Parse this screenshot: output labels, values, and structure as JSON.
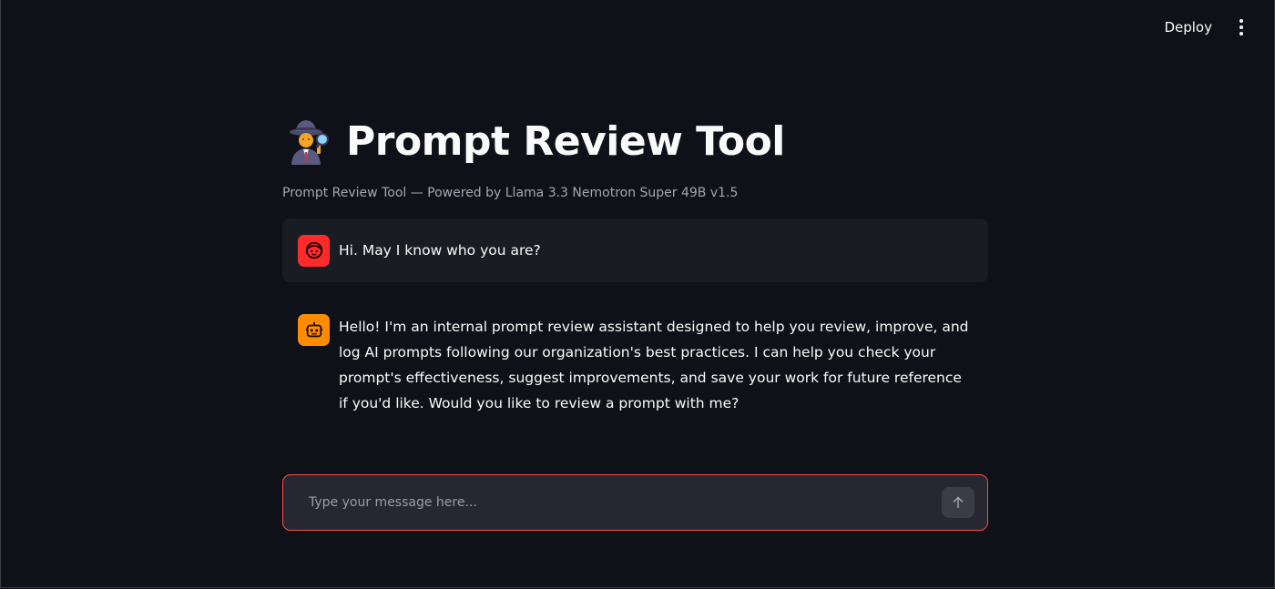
{
  "header": {
    "deploy_label": "Deploy",
    "menu_icon": "kebab-menu-icon"
  },
  "page": {
    "title": "Prompt Review Tool",
    "title_icon": "detective-emoji-icon",
    "caption": "Prompt Review Tool — Powered by Llama 3.3 Nemotron Super 49B v1.5"
  },
  "messages": [
    {
      "role": "user",
      "avatar_icon": "user-face-icon",
      "avatar_color": "#ff2b2b",
      "text": "Hi. May I know who you are?"
    },
    {
      "role": "assistant",
      "avatar_icon": "robot-icon",
      "avatar_color": "#ff8c00",
      "text": "Hello! I'm an internal prompt review assistant designed to help you review, improve, and log AI prompts following our organization's best practices. I can help you check your prompt's effectiveness, suggest improvements, and save your work for future reference if you'd like. Would you like to review a prompt with me?"
    }
  ],
  "chat_input": {
    "placeholder": "Type your message here...",
    "value": "",
    "send_icon": "arrow-up-icon",
    "border_color": "#ff4b4b"
  },
  "colors": {
    "background": "#0e1117",
    "user_message_bg": "#1a1c24",
    "input_bg": "#262730"
  }
}
